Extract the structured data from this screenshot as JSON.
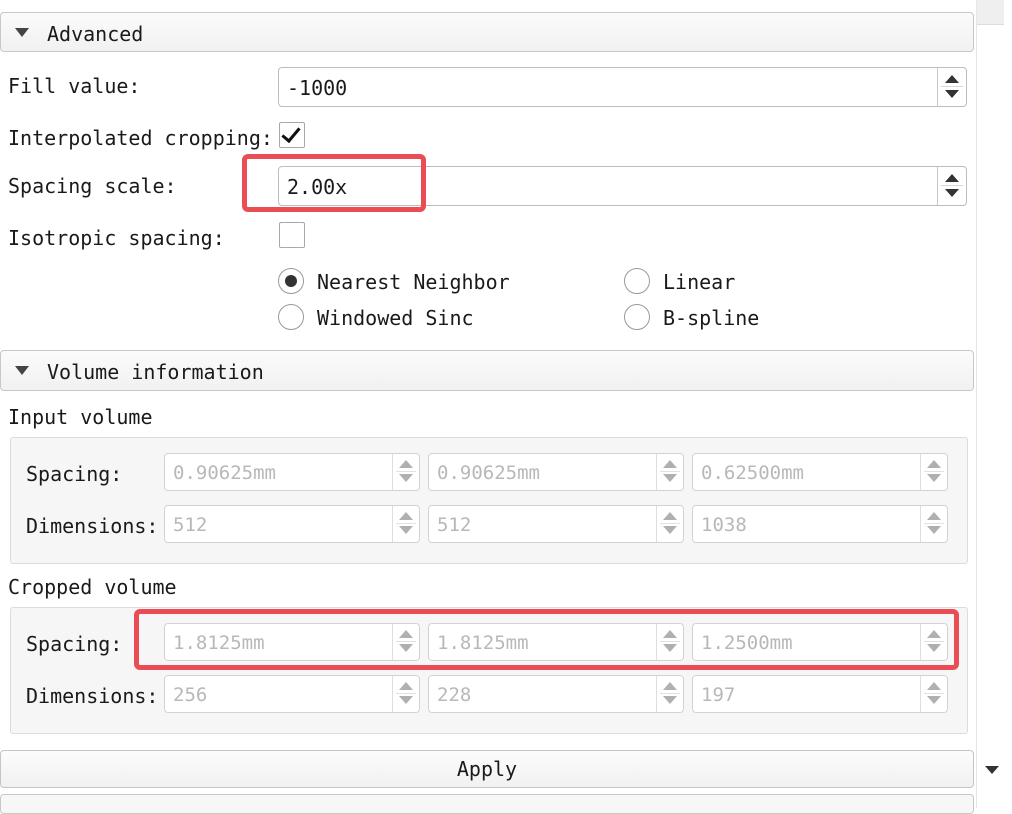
{
  "advanced": {
    "header": "Advanced",
    "fill_value_label": "Fill value:",
    "fill_value": "-1000",
    "interpolated_cropping_label": "Interpolated cropping:",
    "interpolated_cropping_checked": true,
    "spacing_scale_label": "Spacing scale:",
    "spacing_scale": "2.00x",
    "isotropic_spacing_label": "Isotropic spacing:",
    "isotropic_spacing_checked": false,
    "interpolation": {
      "options": [
        "Nearest Neighbor",
        "Linear",
        "Windowed Sinc",
        "B-spline"
      ],
      "selected": "Nearest Neighbor"
    }
  },
  "volume_info": {
    "header": "Volume information",
    "input": {
      "title": "Input volume",
      "spacing_label": "Spacing:",
      "spacing": [
        "0.90625mm",
        "0.90625mm",
        "0.62500mm"
      ],
      "dimensions_label": "Dimensions:",
      "dimensions": [
        "512",
        "512",
        "1038"
      ]
    },
    "cropped": {
      "title": "Cropped volume",
      "spacing_label": "Spacing:",
      "spacing": [
        "1.8125mm",
        "1.8125mm",
        "1.2500mm"
      ],
      "dimensions_label": "Dimensions:",
      "dimensions": [
        "256",
        "228",
        "197"
      ]
    }
  },
  "apply_label": "Apply",
  "highlight_color": "#ea4e54"
}
